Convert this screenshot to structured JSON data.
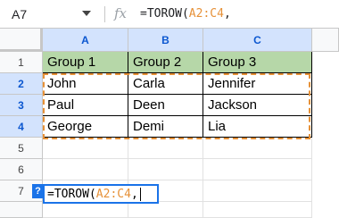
{
  "formula_bar": {
    "name_box": "A7",
    "fx": "fx",
    "formula_prefix": "=TOROW(",
    "formula_ref": "A2:C4",
    "formula_suffix": ","
  },
  "columns": [
    "A",
    "B",
    "C"
  ],
  "rows": [
    "1",
    "2",
    "3",
    "4",
    "5",
    "6",
    "7"
  ],
  "table": {
    "headers": [
      "Group 1",
      "Group 2",
      "Group 3"
    ],
    "body": [
      [
        "John",
        "Carla",
        "Jennifer"
      ],
      [
        "Paul",
        "Deen",
        "Jackson"
      ],
      [
        "George",
        "Demi",
        "Lia"
      ]
    ]
  },
  "editor": {
    "help": "?",
    "prefix": "=TOROW(",
    "ref": "A2:C4",
    "suffix": ","
  },
  "colors": {
    "header_fill": "#b6d7a8",
    "selection_blue": "#1a73e8",
    "reference_orange": "#e69138"
  }
}
